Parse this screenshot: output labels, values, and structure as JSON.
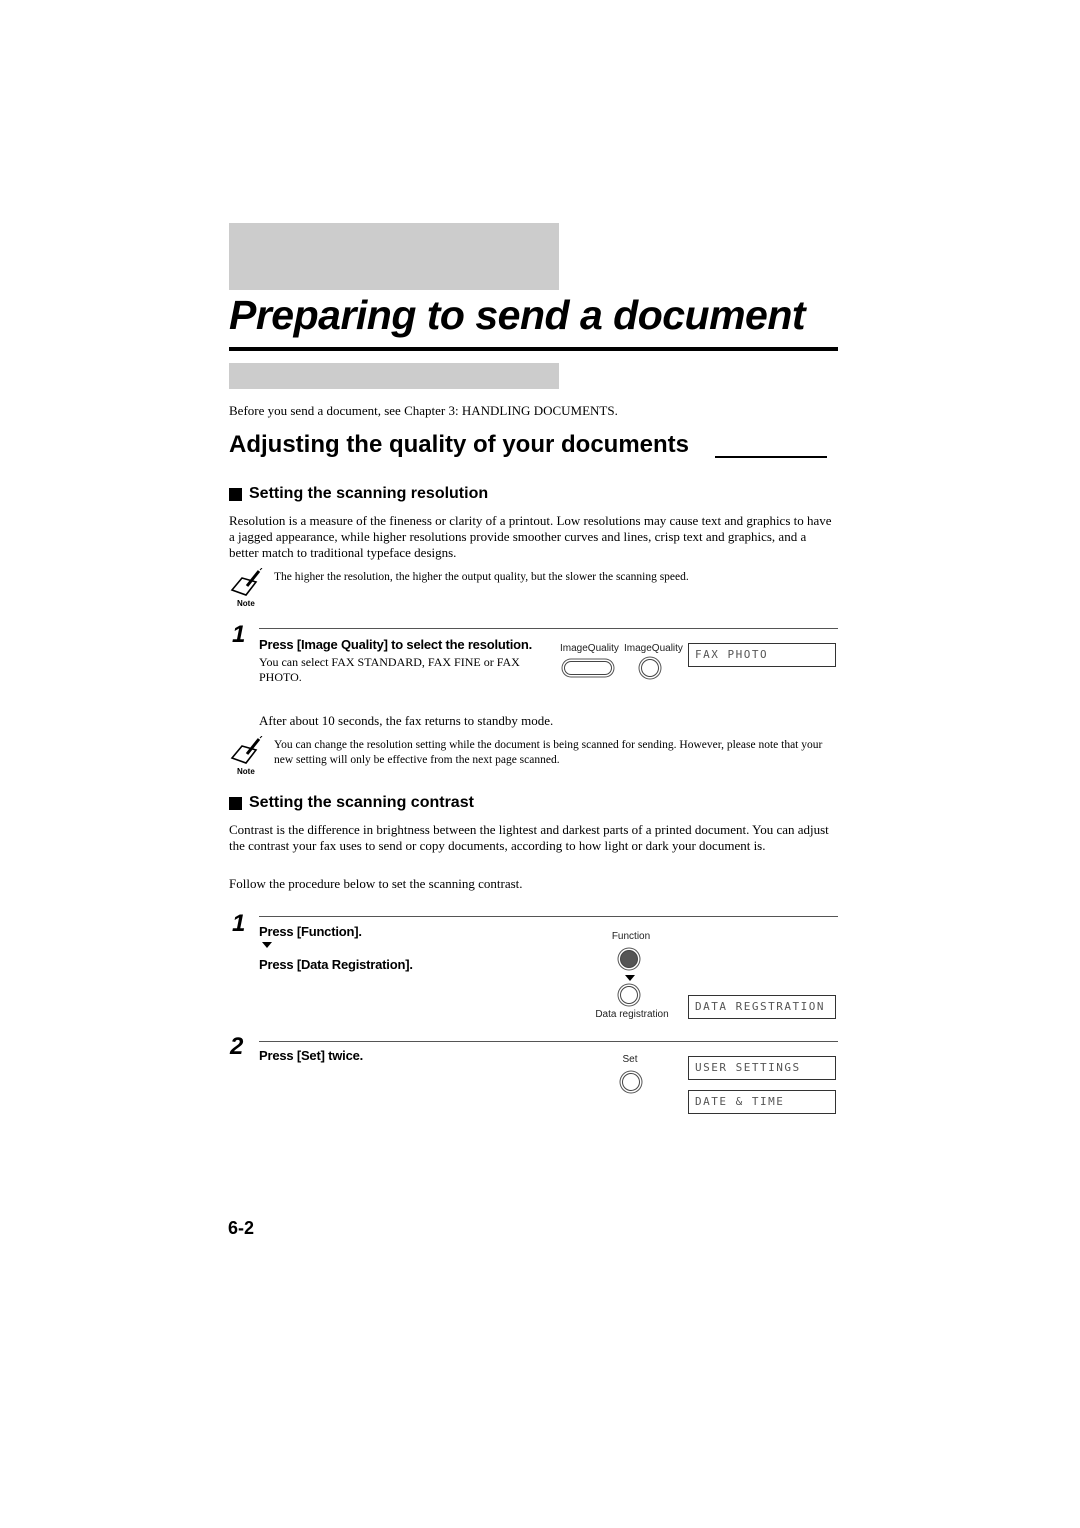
{
  "chapter": {
    "title": "Preparing to send a document",
    "intro": "Before you send a document, see Chapter 3: HANDLING DOCUMENTS."
  },
  "section": {
    "title": "Adjusting the quality of your documents",
    "title_trailing_rule": "________"
  },
  "resolution": {
    "heading": "Setting the scanning resolution",
    "body": "Resolution is a measure of the fineness or clarity of a printout. Low resolutions may cause text and graphics to have a jagged appearance, while higher resolutions provide smoother curves and lines, crisp text and graphics, and a better match to traditional typeface designs.",
    "note1": {
      "icon": "note-pencil-icon",
      "label": "Note",
      "text": "The higher the resolution, the higher the output quality, but the slower the scanning speed."
    },
    "step1": {
      "number": "1",
      "title": "Press [Image Quality] to select the resolution.",
      "detail": "You can select FAX STANDARD, FAX FINE or FAX PHOTO.",
      "button_labels": [
        "ImageQuality",
        "ImageQuality"
      ],
      "display": "FAX PHOTO"
    },
    "after": "After about 10 seconds, the fax returns to standby mode.",
    "note2": {
      "icon": "note-pencil-icon",
      "label": "Note",
      "text": "You can change the resolution setting while the document is being scanned for sending. However, please note that your new setting will only be effective from the next page scanned."
    }
  },
  "contrast": {
    "heading": "Setting the scanning contrast",
    "body": "Contrast is the difference in brightness between the lightest and darkest parts of a printed document. You can adjust the contrast your fax uses to send or copy documents, according to how light or dark your document is.",
    "follow": "Follow the procedure below to set the scanning contrast.",
    "step1": {
      "number": "1",
      "line1": "Press [Function].",
      "line2": "Press [Data Registration].",
      "function_label": "Function",
      "data_reg_label": "Data registration",
      "display": "DATA REGSTRATION"
    },
    "step2": {
      "number": "2",
      "title": "Press [Set] twice.",
      "set_label": "Set",
      "displays": [
        "USER SETTINGS",
        "DATE & TIME"
      ]
    }
  },
  "footer": {
    "page_number": "6-2"
  }
}
